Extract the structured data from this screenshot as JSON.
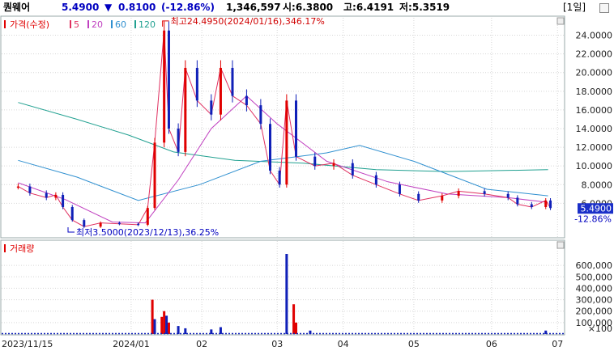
{
  "header": {
    "stock_name": "퀀웨어",
    "price": "5.4900",
    "change_arrow": "▼",
    "change": "0.8100",
    "change_pct": "(-12.86%)",
    "volume": "1,346,597",
    "open": "시:6.3800",
    "high": "고:6.4191",
    "low": "저:5.3519",
    "period_button": "[1일]"
  },
  "legend": {
    "price_label": "가격(수정)",
    "ma_labels": [
      "5",
      "20",
      "60",
      "120"
    ],
    "volume_label": "거래량"
  },
  "annotations": {
    "high": "최고24.4950(2024/01/16),346.17%",
    "low": "최저3.5000(2023/12/13),36.25%"
  },
  "price_axis": {
    "ticks": [
      "24.0000",
      "22.0000",
      "20.0000",
      "18.0000",
      "16.0000",
      "14.0000",
      "12.0000",
      "10.0000",
      "8.0000",
      "6.0000"
    ],
    "current": "5.4900",
    "current_pct": "-12.86%"
  },
  "volume_axis": {
    "ticks": [
      "600,000",
      "500,000",
      "400,000",
      "300,000",
      "200,000",
      "100,000"
    ],
    "unit": "×100"
  },
  "x_axis": {
    "labels": [
      "2023/11/15",
      "2024/01",
      "02",
      "03",
      "04",
      "05",
      "06",
      "07"
    ]
  },
  "colors": {
    "up": "#e00000",
    "down": "#1020b8",
    "ma5": "#e03060",
    "ma20": "#c040c0",
    "ma60": "#3090d0",
    "ma120": "#20a090",
    "header_blue": "#0000c0",
    "current_box": "#1a2fc8"
  },
  "chart_data": {
    "type": "candlestick",
    "series": [
      {
        "name": "가격(수정)",
        "description": "daily price, approximate points",
        "points": [
          [
            "2023-11-15",
            7.8
          ],
          [
            "2023-11-20",
            7.1
          ],
          [
            "2023-11-27",
            6.6
          ],
          [
            "2023-12-01",
            6.9
          ],
          [
            "2023-12-04",
            5.6
          ],
          [
            "2023-12-08",
            4.2
          ],
          [
            "2023-12-13",
            3.5
          ],
          [
            "2023-12-20",
            3.9
          ],
          [
            "2023-12-28",
            3.8
          ],
          [
            "2024-01-05",
            3.7
          ],
          [
            "2024-01-09",
            5.5
          ],
          [
            "2024-01-12",
            12.5
          ],
          [
            "2024-01-16",
            24.5
          ],
          [
            "2024-01-18",
            14.0
          ],
          [
            "2024-01-22",
            11.5
          ],
          [
            "2024-01-25",
            20.5
          ],
          [
            "2024-01-30",
            17.0
          ],
          [
            "2024-02-05",
            15.5
          ],
          [
            "2024-02-09",
            20.5
          ],
          [
            "2024-02-14",
            17.5
          ],
          [
            "2024-02-20",
            16.5
          ],
          [
            "2024-02-26",
            14.5
          ],
          [
            "2024-03-01",
            9.5
          ],
          [
            "2024-03-05",
            8.0
          ],
          [
            "2024-03-08",
            17.0
          ],
          [
            "2024-03-12",
            11.0
          ],
          [
            "2024-03-20",
            10.0
          ],
          [
            "2024-03-28",
            10.3
          ],
          [
            "2024-04-05",
            9.0
          ],
          [
            "2024-04-15",
            8.0
          ],
          [
            "2024-04-25",
            7.0
          ],
          [
            "2024-05-03",
            6.3
          ],
          [
            "2024-05-13",
            6.8
          ],
          [
            "2024-05-20",
            7.3
          ],
          [
            "2024-05-31",
            7.0
          ],
          [
            "2024-06-10",
            6.6
          ],
          [
            "2024-06-14",
            5.9
          ],
          [
            "2024-06-20",
            5.6
          ],
          [
            "2024-06-26",
            6.3
          ],
          [
            "2024-06-28",
            5.49
          ]
        ]
      }
    ],
    "ylim": [
      3.0,
      25.0
    ],
    "current_price": 5.49,
    "high": {
      "value": 24.495,
      "date": "2024/01/16",
      "pct": "346.17%"
    },
    "low": {
      "value": 3.5,
      "date": "2023/12/13",
      "pct": "36.25%"
    },
    "volume": {
      "unit": 100,
      "ylim": [
        0,
        700000
      ],
      "bars": [
        [
          "2024-01-11",
          300000
        ],
        [
          "2024-01-12",
          130000
        ],
        [
          "2024-01-15",
          150000
        ],
        [
          "2024-01-16",
          200000
        ],
        [
          "2024-01-17",
          160000
        ],
        [
          "2024-01-18",
          100000
        ],
        [
          "2024-01-22",
          70000
        ],
        [
          "2024-01-25",
          50000
        ],
        [
          "2024-02-05",
          40000
        ],
        [
          "2024-02-09",
          60000
        ],
        [
          "2024-03-08",
          700000
        ],
        [
          "2024-03-11",
          260000
        ],
        [
          "2024-03-12",
          100000
        ],
        [
          "2024-03-18",
          30000
        ],
        [
          "2024-06-26",
          30000
        ]
      ]
    },
    "x_labels": [
      "2023/11/15",
      "2024/01",
      "02",
      "03",
      "04",
      "05",
      "06",
      "07"
    ],
    "grid": true
  }
}
